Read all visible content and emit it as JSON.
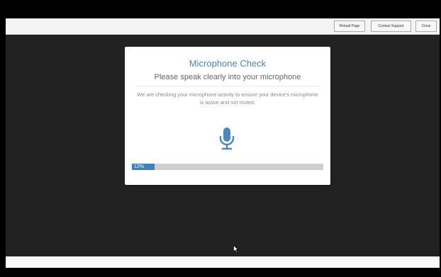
{
  "toolbar": {
    "reload_label": "Reload Page",
    "support_label": "Contact Support",
    "close_label": "Close"
  },
  "dialog": {
    "title": "Microphone Check",
    "subtitle": "Please speak clearly into your microphone",
    "description": "We are checking your microphone activity to ensure your device's microphone is active and not muted.",
    "icon": "microphone-icon",
    "progress": {
      "percent": 12,
      "label": "12%"
    }
  },
  "colors": {
    "accent": "#4a86bf",
    "progress_fill": "#3b82c4",
    "progress_track": "#cfcfcf",
    "stage_background": "#222222"
  }
}
